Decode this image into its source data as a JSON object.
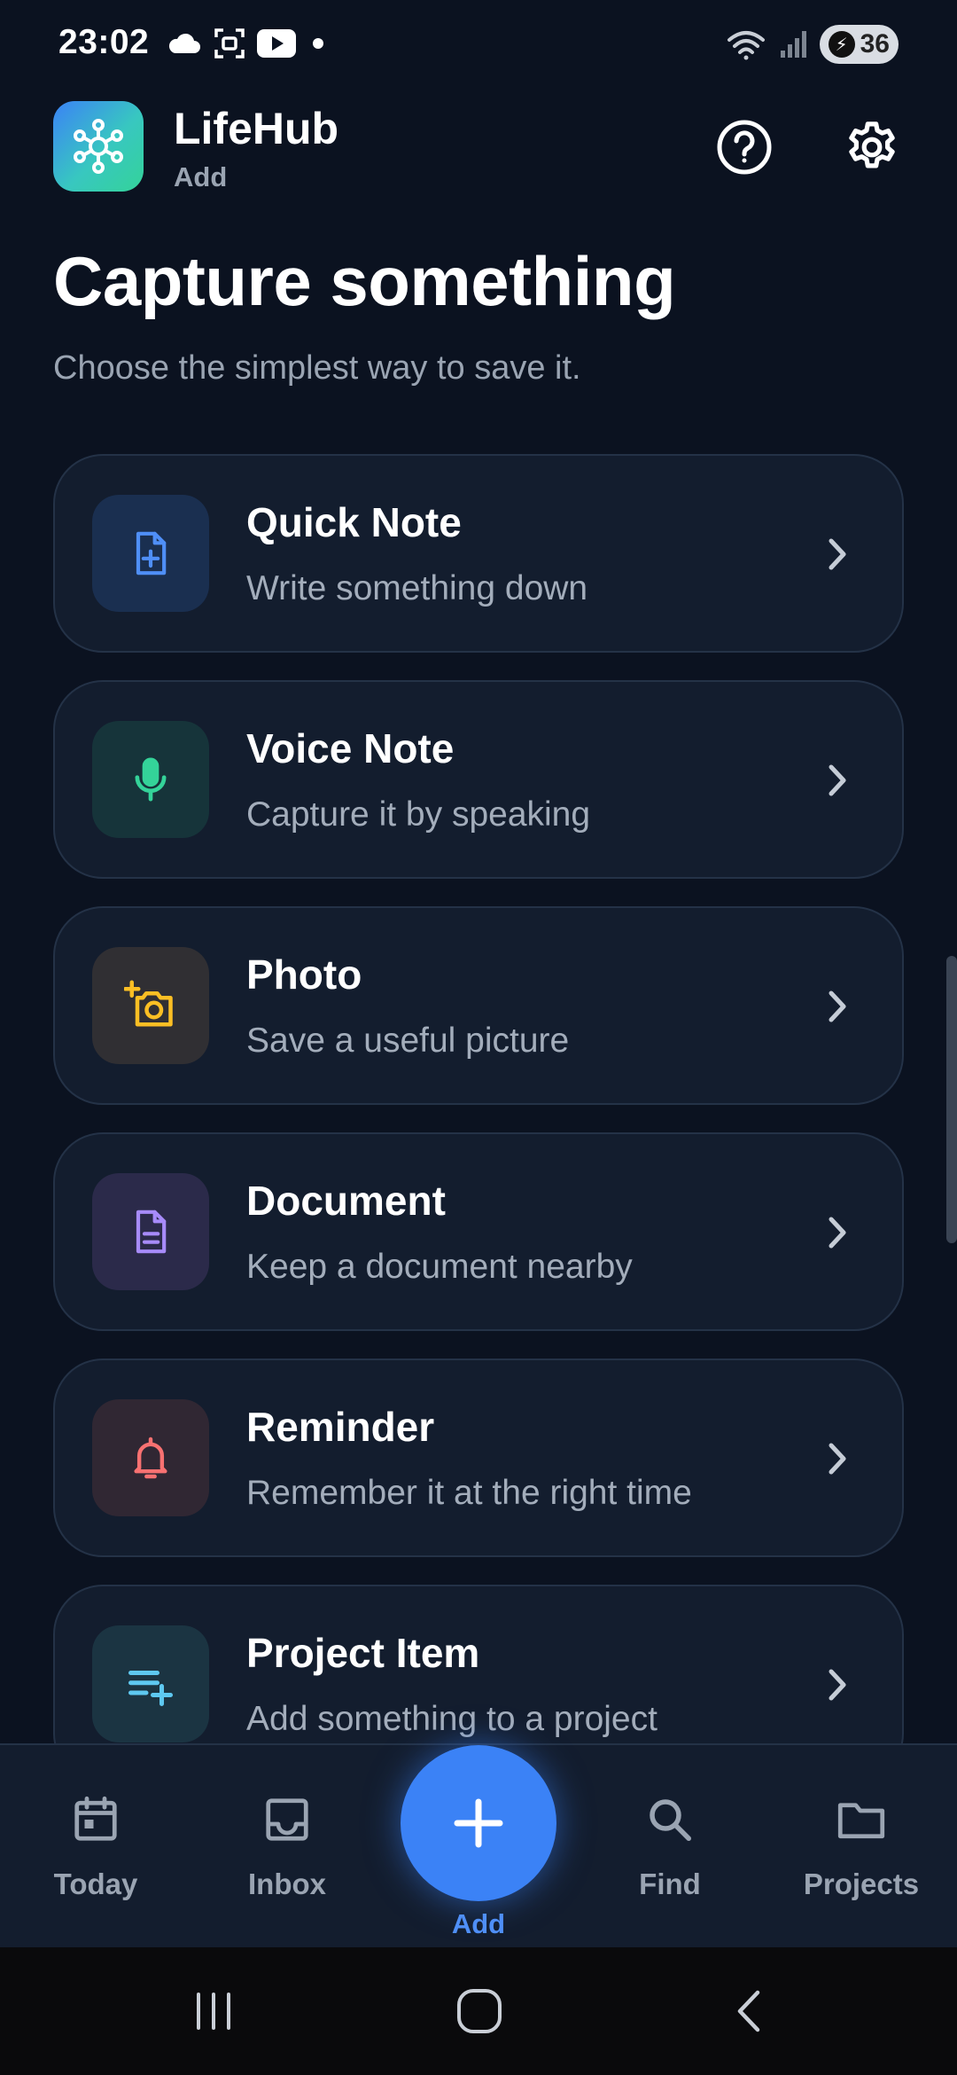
{
  "status_bar": {
    "time": "23:02",
    "battery": "36",
    "icons_left": [
      "cloud-icon",
      "screenshot-icon",
      "youtube-icon",
      "dot-icon"
    ],
    "icons_right": [
      "wifi-icon",
      "signal-icon",
      "battery-icon"
    ]
  },
  "header": {
    "app_name": "LifeHub",
    "section": "Add",
    "actions": [
      "help-icon",
      "settings-icon"
    ]
  },
  "page": {
    "title": "Capture something",
    "subtitle": "Choose the simplest way to save it."
  },
  "cards": [
    {
      "title": "Quick Note",
      "description": "Write something down",
      "icon": "note-add-icon",
      "icon_color": "#4f8ff7",
      "icon_bg": "#1a2f50"
    },
    {
      "title": "Voice Note",
      "description": "Capture it by speaking",
      "icon": "microphone-icon",
      "icon_color": "#34d399",
      "icon_bg": "#16343a"
    },
    {
      "title": "Photo",
      "description": "Save a useful picture",
      "icon": "add-photo-icon",
      "icon_color": "#fbbf24",
      "icon_bg": "#302f33"
    },
    {
      "title": "Document",
      "description": "Keep a document nearby",
      "icon": "document-icon",
      "icon_color": "#a78bfa",
      "icon_bg": "#2b2a4a"
    },
    {
      "title": "Reminder",
      "description": "Remember it at the right time",
      "icon": "bell-icon",
      "icon_color": "#f87171",
      "icon_bg": "#302733"
    },
    {
      "title": "Project Item",
      "description": "Add something to a project",
      "icon": "playlist-add-icon",
      "icon_color": "#5ec8f0",
      "icon_bg": "#1b3442"
    }
  ],
  "bottom_nav": {
    "items": [
      {
        "label": "Today",
        "icon": "calendar-icon"
      },
      {
        "label": "Inbox",
        "icon": "inbox-icon"
      },
      {
        "label": "Add",
        "icon": "plus-icon",
        "active": true
      },
      {
        "label": "Find",
        "icon": "search-icon"
      },
      {
        "label": "Projects",
        "icon": "folder-icon"
      }
    ]
  },
  "colors": {
    "background": "#0b1220",
    "card": "#131d2e",
    "accent": "#3b82f6",
    "muted_text": "#9aa4b2"
  }
}
